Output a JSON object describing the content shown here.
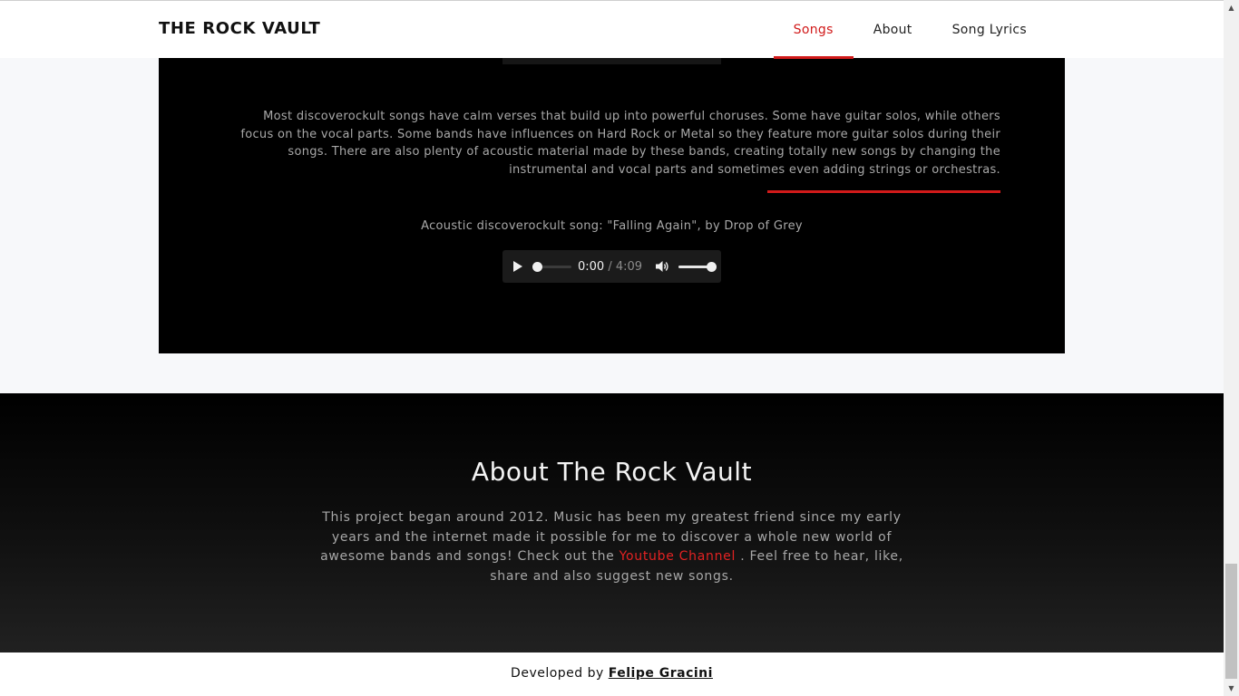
{
  "header": {
    "brand": "THE ROCK VAULT",
    "nav": [
      {
        "label": "Songs",
        "active": true
      },
      {
        "label": "About",
        "active": false
      },
      {
        "label": "Song Lyrics",
        "active": false
      }
    ]
  },
  "songs": {
    "description": "Most discoverockult songs have calm verses that build up into powerful choruses. Some have guitar solos, while others focus on the vocal parts. Some bands have influences on Hard Rock or Metal so they feature more guitar solos during their songs. There are also plenty of acoustic material made by these bands, creating totally new songs by changing the instrumental and vocal parts and sometimes even adding strings or orchestras.",
    "caption": "Acoustic discoverockult song: \"Falling Again\", by Drop of Grey",
    "player": {
      "current_time": "0:00",
      "separator": " / ",
      "duration": "4:09",
      "progress": 0,
      "volume": 1.0
    }
  },
  "about": {
    "title": "About The Rock Vault",
    "text_before_link": "This project began around 2012. Music has been my greatest friend since my early years and the internet made it possible for me to discover a whole new world of awesome bands and songs! Check out the ",
    "link_label": "Youtube Channel",
    "text_after_link": " . Feel free to hear, like, share and also suggest new songs."
  },
  "footer": {
    "prefix": "Developed by ",
    "author": "Felipe Gracini"
  },
  "icons": {
    "play": "play-icon",
    "volume": "volume-icon",
    "scroll_up": "chevron-up-icon",
    "scroll_down": "chevron-down-icon"
  },
  "colors": {
    "accent": "#d11a1a",
    "panel_bg": "#000000",
    "page_bg": "#f7f8fa"
  }
}
